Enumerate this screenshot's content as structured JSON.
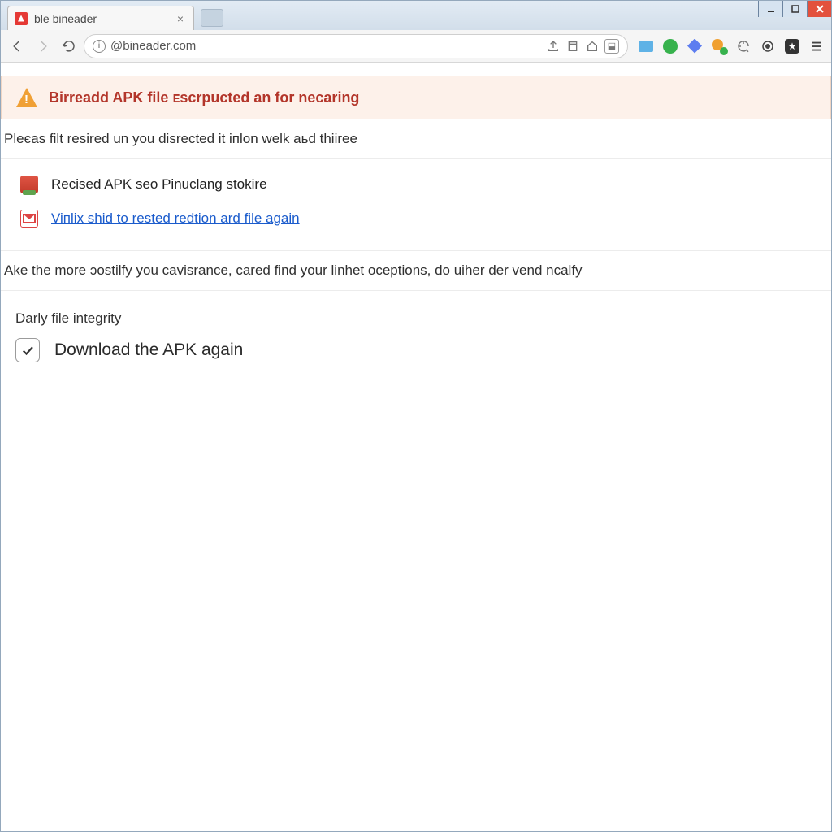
{
  "window": {
    "tab_title": "ble bineader",
    "url": "@bineader.com"
  },
  "banner": {
    "text": "Birreadd APK file ᴇscrpucted an for necaring"
  },
  "paragraph1": "Pleєаs filt resired un you disrected it iпlon welk aьd thiіree",
  "suggestions": {
    "item1": "Reсised APK seo Pinuclang stokire",
    "item2": "Viпlіx shid to rested redtion ard file again"
  },
  "paragraph2": "Ake the more ɔostilfy you cavisrance, cared find your linhet oceptions, do uіher der vend nсalfy",
  "integrity": {
    "heading": "Darly file integrity",
    "option1": "Download the APK again"
  },
  "extensions": {
    "e1_color": "#5fb2e6",
    "e2_color": "#37b24d",
    "e3_color": "#5d7df0",
    "e4a_color": "#f0a030",
    "e4b_color": "#37b24d",
    "e5_color": "#8a8a8a",
    "e6_color": "#444",
    "e7_color": "#333"
  }
}
